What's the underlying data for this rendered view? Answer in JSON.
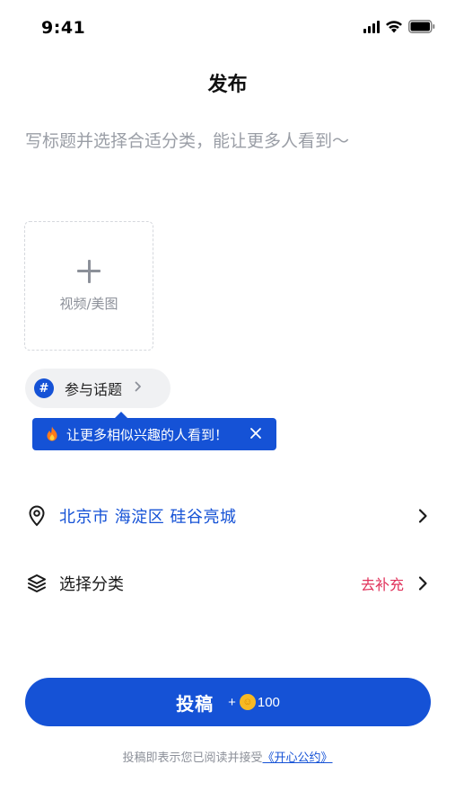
{
  "status_bar": {
    "time": "9:41"
  },
  "header": {
    "title": "发布"
  },
  "title_input": {
    "placeholder": "写标题并选择合适分类，能让更多人看到～",
    "value": ""
  },
  "media": {
    "label": "视频/美图"
  },
  "topic": {
    "label": "参与话题",
    "hash_symbol": "#"
  },
  "tooltip": {
    "text": "让更多相似兴趣的人看到！"
  },
  "location": {
    "text": "北京市 海淀区 硅谷亮城"
  },
  "category": {
    "label": "选择分类",
    "action": "去补充"
  },
  "publish": {
    "label": "投稿",
    "reward_prefix": "+",
    "reward_value": "100"
  },
  "agreement": {
    "text": "投稿即表示您已阅读并接受",
    "link": "《开心公约》"
  },
  "colors": {
    "accent": "#1552d6",
    "warning": "#e0315a",
    "coin": "#f7b924"
  }
}
